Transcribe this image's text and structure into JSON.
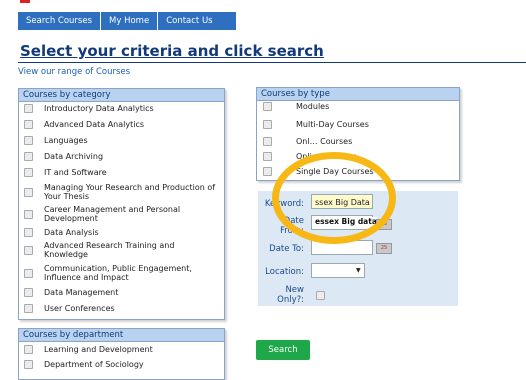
{
  "nav": {
    "items": [
      "Search Courses",
      "My Home",
      "Contact Us"
    ]
  },
  "header": {
    "title": "Select your criteria and click search",
    "view_link": "View our range of Courses"
  },
  "category_panel": {
    "title": "Courses by category",
    "items": [
      "Introductory Data Analytics",
      "Advanced Data Analytics",
      "Languages",
      "Data Archiving",
      "IT and Software",
      "Managing Your Research and Production of Your Thesis",
      "Career Management and Personal Development",
      "Data Analysis",
      "Advanced Research Training and Knowledge",
      "Communication, Public Engagement, Influence and Impact",
      "Data Management",
      "User Conferences"
    ]
  },
  "type_panel": {
    "title": "Courses by type",
    "items": [
      "Modules",
      "Multi-Day Courses",
      "Onl… Courses",
      "Online Courses",
      "Single Day Courses"
    ]
  },
  "department_panel": {
    "title": "Courses by department",
    "items": [
      "Learning and Development",
      "Department of Sociology"
    ]
  },
  "form": {
    "keyword_label": "Keyword:",
    "keyword_value": "ssex Big Data",
    "date_from_label": "Date From:",
    "tooltip": "essex Big data",
    "date_to_label": "Date To:",
    "location_label": "Location:",
    "location_value": "",
    "new_only_label": "New Only?:",
    "cal_icon_text": "25"
  },
  "search_button": "Search",
  "colors": {
    "nav": "#2f6fbf",
    "title": "#123a7a",
    "panel_head": "#b8d2f0",
    "search": "#1ea84a",
    "highlight": "#f7b815"
  }
}
